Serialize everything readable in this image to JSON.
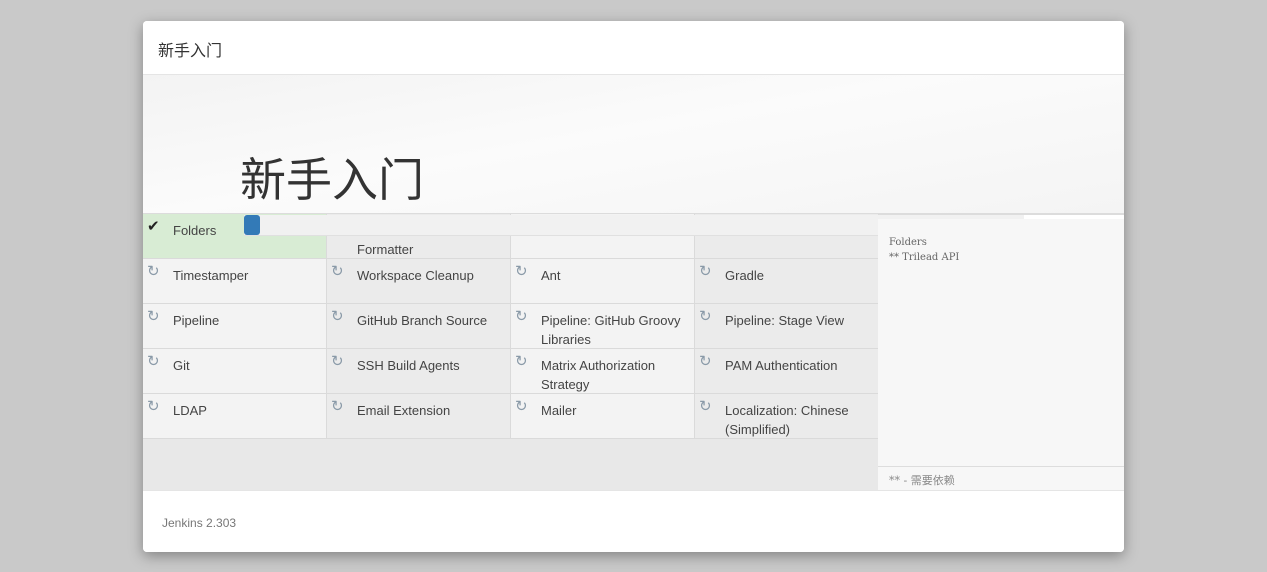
{
  "dialog": {
    "title": "新手入门",
    "hero_title": "新手入门",
    "footer_version": "Jenkins 2.303"
  },
  "install_progress": 0.02,
  "plugins": [
    {
      "label": "Folders",
      "status": "installed",
      "icon": "check-icon"
    },
    {
      "label": "Formatter",
      "status": "pending",
      "icon": "refresh-icon"
    },
    {
      "label": "",
      "status": "pending",
      "icon": "refresh-icon"
    },
    {
      "label": "",
      "status": "pending",
      "icon": "refresh-icon"
    },
    {
      "label": "Timestamper",
      "status": "pending",
      "icon": "refresh-icon"
    },
    {
      "label": "Workspace Cleanup",
      "status": "pending",
      "icon": "refresh-icon"
    },
    {
      "label": "Ant",
      "status": "pending",
      "icon": "refresh-icon"
    },
    {
      "label": "Gradle",
      "status": "pending",
      "icon": "refresh-icon"
    },
    {
      "label": "Pipeline",
      "status": "pending",
      "icon": "refresh-icon"
    },
    {
      "label": "GitHub Branch Source",
      "status": "pending",
      "icon": "refresh-icon"
    },
    {
      "label": "Pipeline: GitHub Groovy Libraries",
      "status": "pending",
      "icon": "refresh-icon"
    },
    {
      "label": "Pipeline: Stage View",
      "status": "pending",
      "icon": "refresh-icon"
    },
    {
      "label": "Git",
      "status": "pending",
      "icon": "refresh-icon"
    },
    {
      "label": "SSH Build Agents",
      "status": "pending",
      "icon": "refresh-icon"
    },
    {
      "label": "Matrix Authorization Strategy",
      "status": "pending",
      "icon": "refresh-icon"
    },
    {
      "label": "PAM Authentication",
      "status": "pending",
      "icon": "refresh-icon"
    },
    {
      "label": "LDAP",
      "status": "pending",
      "icon": "refresh-icon"
    },
    {
      "label": "Email Extension",
      "status": "pending",
      "icon": "refresh-icon"
    },
    {
      "label": "Mailer",
      "status": "pending",
      "icon": "refresh-icon"
    },
    {
      "label": "Localization: Chinese (Simplified)",
      "status": "pending",
      "icon": "refresh-icon"
    }
  ],
  "log": {
    "lines": [
      "Folders",
      "** Trilead API"
    ],
    "footer": "** - 需要依赖"
  },
  "colors": {
    "installed": "#d8ecd4",
    "progress": "#337ab7"
  }
}
